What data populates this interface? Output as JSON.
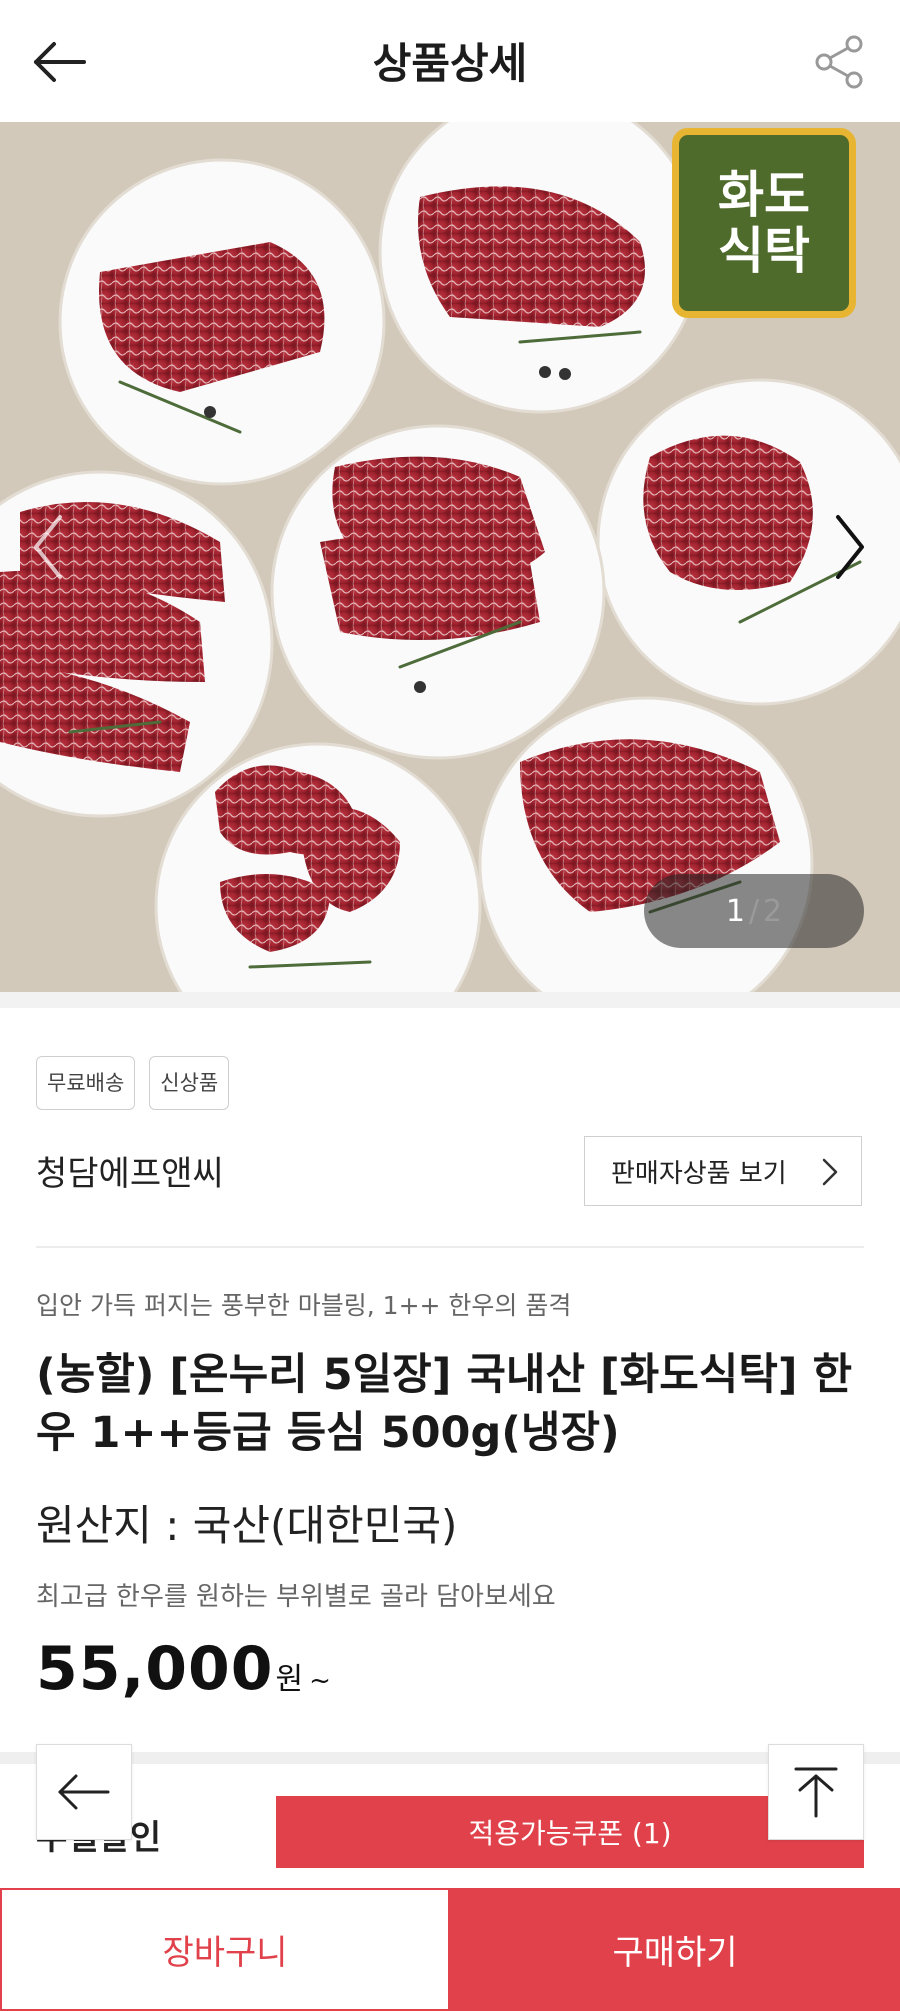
{
  "header": {
    "title": "상품상세",
    "back_icon": "arrow-left-icon",
    "share_icon": "share-icon"
  },
  "gallery": {
    "brand_logo_text": "화도\n식탁",
    "current": "1",
    "separator": "/",
    "total": "2",
    "prev_icon": "chevron-left-icon",
    "next_icon": "chevron-right-icon"
  },
  "tags": [
    "무료배송",
    "신상품"
  ],
  "seller": {
    "name": "청담에프앤씨",
    "button_label": "판매자상품 보기"
  },
  "product": {
    "subtitle": "입안 가득 퍼지는 풍부한 마블링, 1++ 한우의 품격",
    "name": "(농할) [온누리 5일장] 국내산 [화도식탁] 한우 1++등급 등심 500g(냉장)",
    "origin": "원산지 : 국산(대한민국)",
    "description": "최고급 한우를 원하는 부위별로 골라 담아보세요",
    "price": "55,000",
    "price_unit": "원",
    "price_suffix": "~"
  },
  "coupon": {
    "label_partial": "두벌알인",
    "button_label": "적용가능쿠폰 (1)"
  },
  "bottom": {
    "cart_label": "장바구니",
    "buy_label": "구매하기"
  },
  "colors": {
    "accent": "#e0414a",
    "brand_green": "#4f6b2c",
    "brand_gold": "#e7b531"
  }
}
